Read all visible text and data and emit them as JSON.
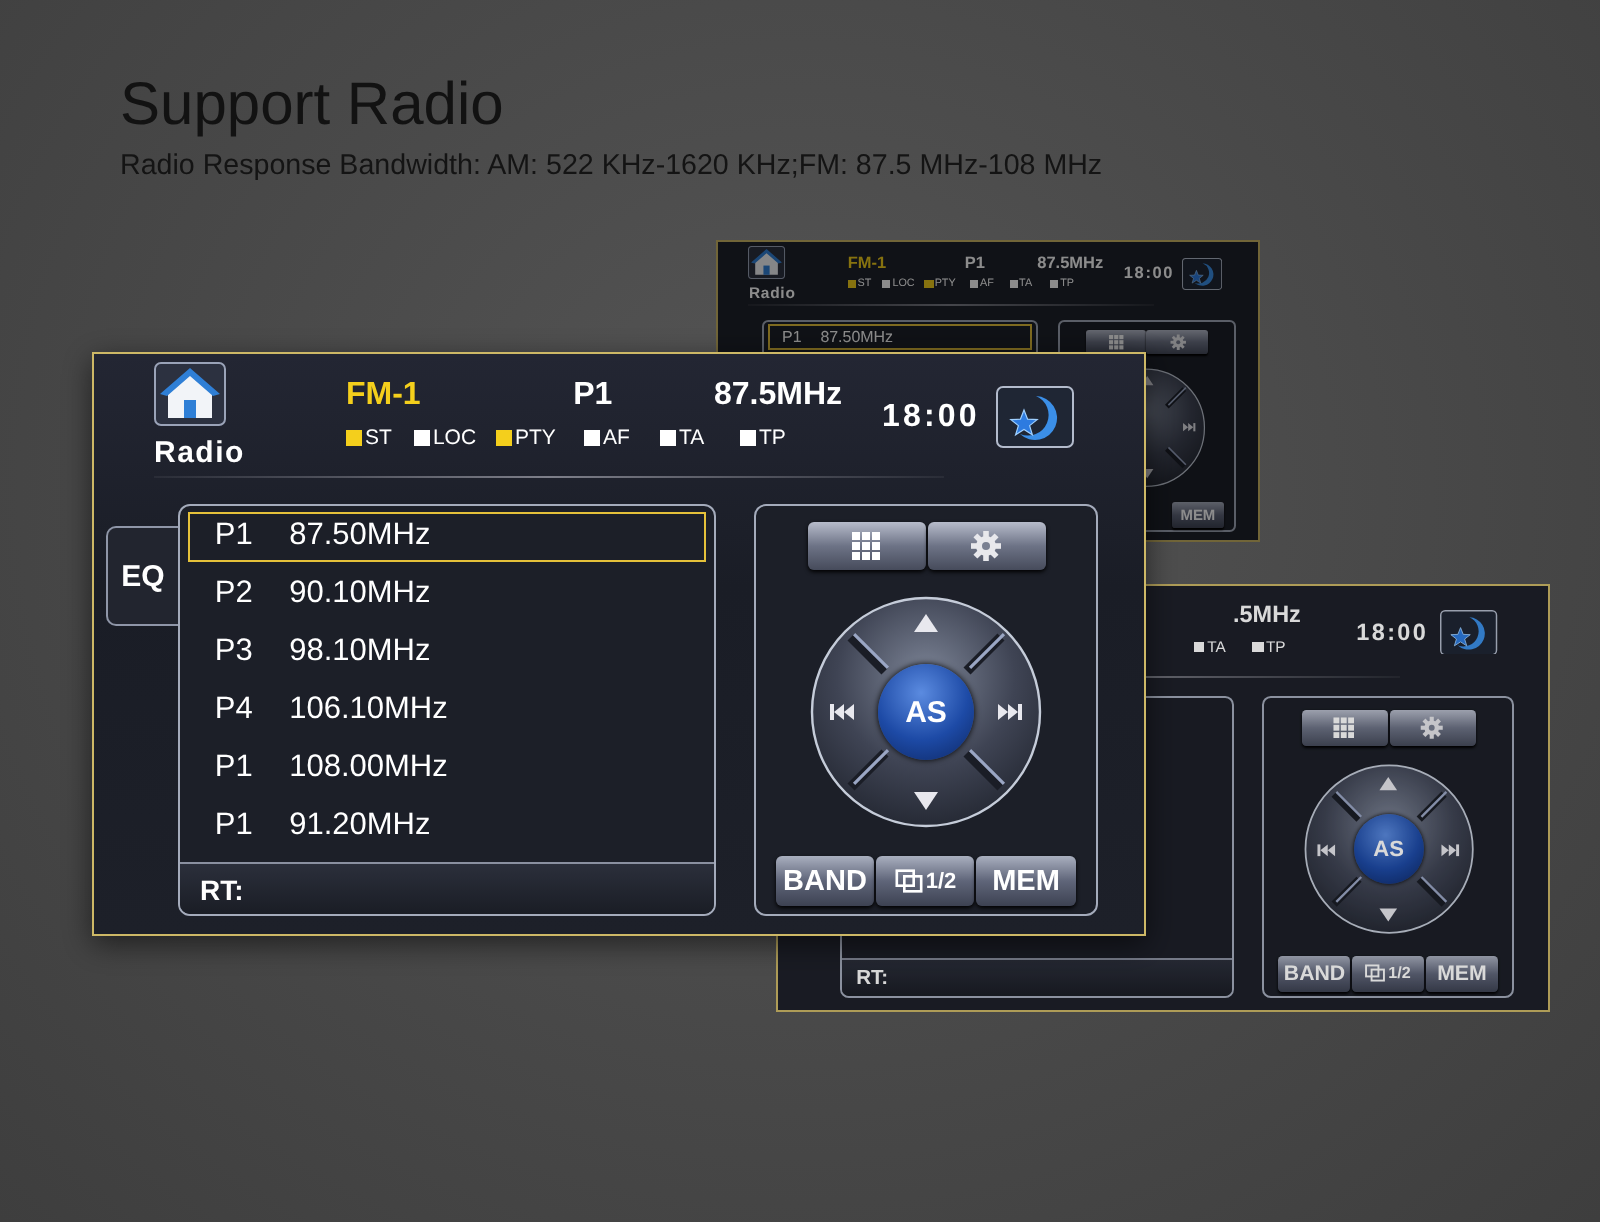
{
  "heading": {
    "title": "Support Radio",
    "subtitle": "Radio Response Bandwidth: AM: 522 KHz-1620 KHz;FM: 87.5 MHz-108 MHz"
  },
  "upper_back_screen": {
    "app_label": "Radio",
    "band": "FM-1",
    "preset": "P1",
    "frequency": "87.5MHz",
    "indicators": [
      {
        "kind": "st",
        "label": "ST",
        "on": true
      },
      {
        "kind": "loc",
        "label": "LOC",
        "on": false
      },
      {
        "kind": "pty",
        "label": "PTY",
        "on": true
      },
      {
        "kind": "af",
        "label": "AF",
        "on": false
      },
      {
        "kind": "ta",
        "label": "TA",
        "on": false
      },
      {
        "kind": "tp",
        "label": "TP",
        "on": false
      }
    ],
    "clock": "18:00",
    "presets": [
      {
        "channel": "P1",
        "frequency": "87.50MHz",
        "selected": true
      }
    ],
    "bottom_buttons": [
      {
        "kind": "mem",
        "label": "MEM"
      }
    ]
  },
  "lower_back_screen": {
    "frequency": ".5MHz",
    "indicators": [
      {
        "kind": "ta",
        "label": "TA",
        "on": false
      },
      {
        "kind": "tp",
        "label": "TP",
        "on": false
      }
    ],
    "clock": "18:00",
    "rt_label": "RT:",
    "as_button": "AS",
    "bottom_buttons": [
      {
        "kind": "band",
        "label": "BAND"
      },
      {
        "kind": "page",
        "label": "1/2"
      },
      {
        "kind": "mem",
        "label": "MEM"
      }
    ]
  },
  "main_screen": {
    "app_label": "Radio",
    "band": "FM-1",
    "preset": "P1",
    "frequency": "87.5MHz",
    "indicators": [
      {
        "kind": "st",
        "label": "ST",
        "on": true
      },
      {
        "kind": "loc",
        "label": "LOC",
        "on": false
      },
      {
        "kind": "pty",
        "label": "PTY",
        "on": true
      },
      {
        "kind": "af",
        "label": "AF",
        "on": false
      },
      {
        "kind": "ta",
        "label": "TA",
        "on": false
      },
      {
        "kind": "tp",
        "label": "TP",
        "on": false
      }
    ],
    "clock": "18:00",
    "eq_tab": "EQ",
    "presets": [
      {
        "channel": "P1",
        "frequency": "87.50MHz",
        "selected": true
      },
      {
        "channel": "P2",
        "frequency": "90.10MHz",
        "selected": false
      },
      {
        "channel": "P3",
        "frequency": "98.10MHz",
        "selected": false
      },
      {
        "channel": "P4",
        "frequency": "106.10MHz",
        "selected": false
      },
      {
        "channel": "P1",
        "frequency": "108.00MHz",
        "selected": false
      },
      {
        "channel": "P1",
        "frequency": "91.20MHz",
        "selected": false
      }
    ],
    "rt_label": "RT:",
    "as_button": "AS",
    "bottom_buttons": [
      {
        "kind": "band",
        "label": "BAND"
      },
      {
        "kind": "page",
        "label": "1/2"
      },
      {
        "kind": "mem",
        "label": "MEM"
      }
    ]
  }
}
